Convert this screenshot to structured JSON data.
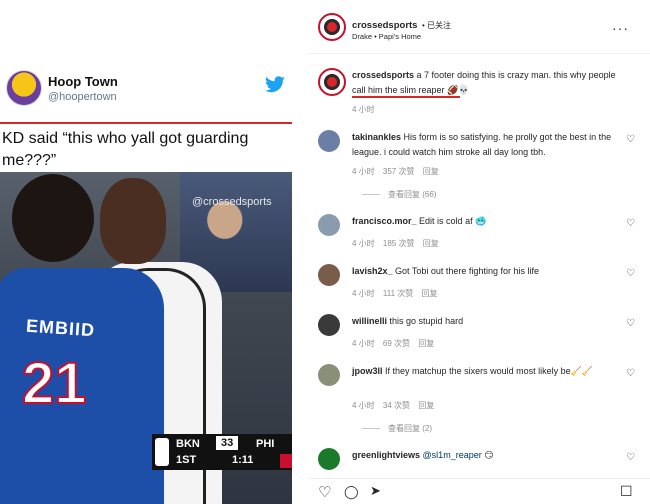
{
  "tweet": {
    "name": "Hoop Town",
    "handle": "@hoopertown",
    "text": "KD said “this who yall got guarding me???”"
  },
  "photo": {
    "watermark": "@crossedsports",
    "jersey_name": "EMBIID",
    "jersey_number": "21",
    "scoreboard": {
      "team1": "BKN",
      "score": "33",
      "team2": "PHI",
      "quarter": "1ST",
      "clock": "1:11"
    }
  },
  "post": {
    "username": "crossedsports",
    "follow_status": "• 已关注",
    "audio": "Drake • Papi's Home",
    "more_icon": "more-options-icon",
    "caption": {
      "username": "crossedsports",
      "text": "a 7 footer doing this is crazy man. this why people call him the slim reaper 🏈💀",
      "time": "4 小时"
    },
    "comments": [
      {
        "username": "takinankles",
        "text": "His form is so satisfying. he prolly got the best in the league. i could watch him stroke all day long tbh.",
        "time": "4 小时",
        "likes": "357 次赞",
        "reply": "回复",
        "view_replies": "查看回复 (66)",
        "avatar_color": "#6b7fa6"
      },
      {
        "username": "francisco.mor_",
        "text": "Edit is cold af 🥶",
        "time": "4 小时",
        "likes": "185 次赞",
        "reply": "回复",
        "avatar_color": "#8a9bb0"
      },
      {
        "username": "lavish2x_",
        "text": "Got Tobi out there fighting for his life",
        "time": "4 小时",
        "likes": "111 次赞",
        "reply": "回复",
        "avatar_color": "#7a5c4a"
      },
      {
        "username": "willinelli",
        "text": "this go stupid hard",
        "time": "4 小时",
        "likes": "69 次赞",
        "reply": "回复",
        "avatar_color": "#3a3a3a"
      },
      {
        "username": "jpow3ll",
        "text": "If they matchup the sixers would most likely be🧹🧹",
        "time": "4 小时",
        "likes": "34 次赞",
        "reply": "回复",
        "view_replies": "查看回复 (2)",
        "avatar_color": "#8a8f7a"
      },
      {
        "username": "greenlightviews",
        "mention": "@sl1m_reaper",
        "text": "😏",
        "avatar_color": "#1a7a2a"
      }
    ]
  },
  "icons": {
    "heart": "♡",
    "like": "♡",
    "comment": "◯",
    "share": "➤",
    "save": "☐"
  }
}
